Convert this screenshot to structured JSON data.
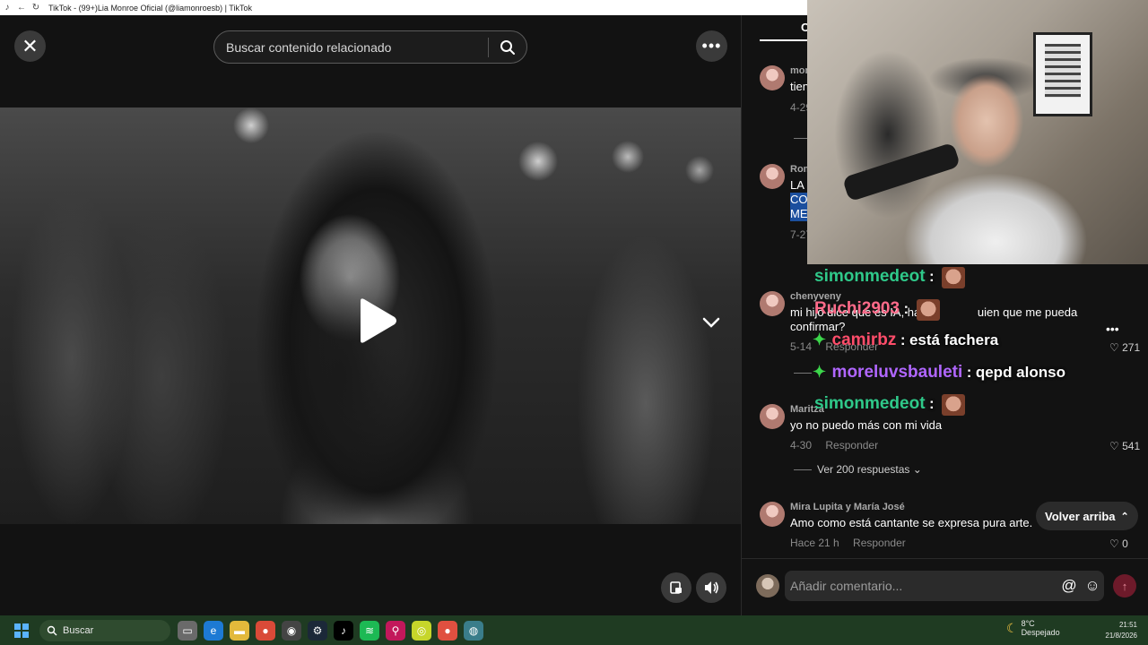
{
  "browser": {
    "tab_title": "TikTok - (99+)Lia Monroe Oficial (@liamonroesb) | TikTok"
  },
  "video": {
    "search_placeholder": "Buscar contenido relacionado"
  },
  "comments": {
    "tab_label": "C",
    "items": [
      {
        "username": "mon",
        "text": "tien",
        "date": "4-29",
        "reply": "",
        "likes": ""
      },
      {
        "username": "Rom",
        "lines": [
          "LA",
          "CO",
          "ME"
        ],
        "date": "7-27",
        "reply": "",
        "likes": ""
      },
      {
        "username": "chenyveny",
        "lines": [
          "mi hijo dice que es IA, ha",
          "confirmar?"
        ],
        "line1_tail": "uien que me pueda",
        "date": "5-14",
        "reply": "Responder",
        "likes": "271"
      },
      {
        "username": "Maritza",
        "text": "yo no puedo más con mi vida",
        "date": "4-30",
        "reply": "Responder",
        "likes": "541"
      },
      {
        "username": "Mira Lupita y María José",
        "text": "Amo como está cantante se expresa pura arte.",
        "date": "Hace 21 h",
        "reply": "Responder",
        "likes": "0"
      }
    ],
    "view_replies": "Ver 200 respuestas",
    "back_to_top": "Volver arriba",
    "add_comment_placeholder": "Añadir comentario..."
  },
  "chat_overlay": [
    {
      "user": "simonmedeot",
      "sep": ":",
      "msg": "",
      "color": "#2fc98a"
    },
    {
      "user": "Ruchi2903",
      "sep": ":",
      "msg": "",
      "color": "#ff6b8a"
    },
    {
      "user": "camirbz",
      "sep": ":",
      "msg": "está fachera",
      "color": "#ff4d6a"
    },
    {
      "user": "moreluvsbauleti",
      "sep": ":",
      "msg": "qepd alonso",
      "color": "#b066ff"
    },
    {
      "user": "simonmedeot",
      "sep": ":",
      "msg": "",
      "color": "#2fc98a"
    }
  ],
  "taskbar": {
    "search_label": "Buscar",
    "temperature": "8°C",
    "weather": "Despejado",
    "time": "21:51",
    "date": "21/8/2026"
  }
}
